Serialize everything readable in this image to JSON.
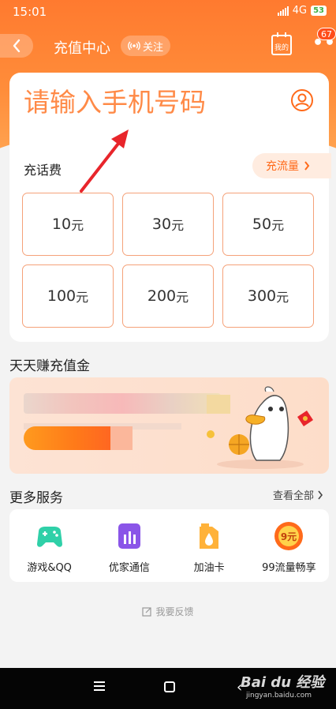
{
  "status_bar": {
    "time": "15:01",
    "network": "4G",
    "battery": "53"
  },
  "header": {
    "title": "充值中心",
    "follow_label": "关注",
    "mine_label": "我的",
    "more_label": "•••",
    "badge_count": "67"
  },
  "recharge": {
    "phone_placeholder": "请输入手机号码",
    "section_label": "充话费",
    "flow_button": "充流量",
    "unit": "元",
    "amounts": [
      "10",
      "30",
      "50",
      "100",
      "200",
      "300"
    ]
  },
  "earn": {
    "title": "天天赚充值金"
  },
  "services": {
    "title": "更多服务",
    "view_all": "查看全部",
    "items": [
      {
        "label": "游戏&QQ",
        "icon": "gamepad-icon",
        "color": "#2fd0a8"
      },
      {
        "label": "优家通信",
        "icon": "signal-bars-icon",
        "color": "#8a55e8"
      },
      {
        "label": "加油卡",
        "icon": "fuel-drop-icon",
        "color": "#ffb23a"
      },
      {
        "label": "99流量畅享",
        "icon": "nine-yuan-badge-icon",
        "color": "#ff6a1a",
        "badge_text": "9元"
      }
    ]
  },
  "feedback": {
    "label": "我要反馈"
  },
  "watermark": {
    "brand": "Bai du 经验",
    "url": "jingyan.baidu.com"
  },
  "colors": {
    "brand_orange": "#ff7a2f",
    "amount_border": "#f5a27a",
    "background": "#f3f3f3"
  }
}
